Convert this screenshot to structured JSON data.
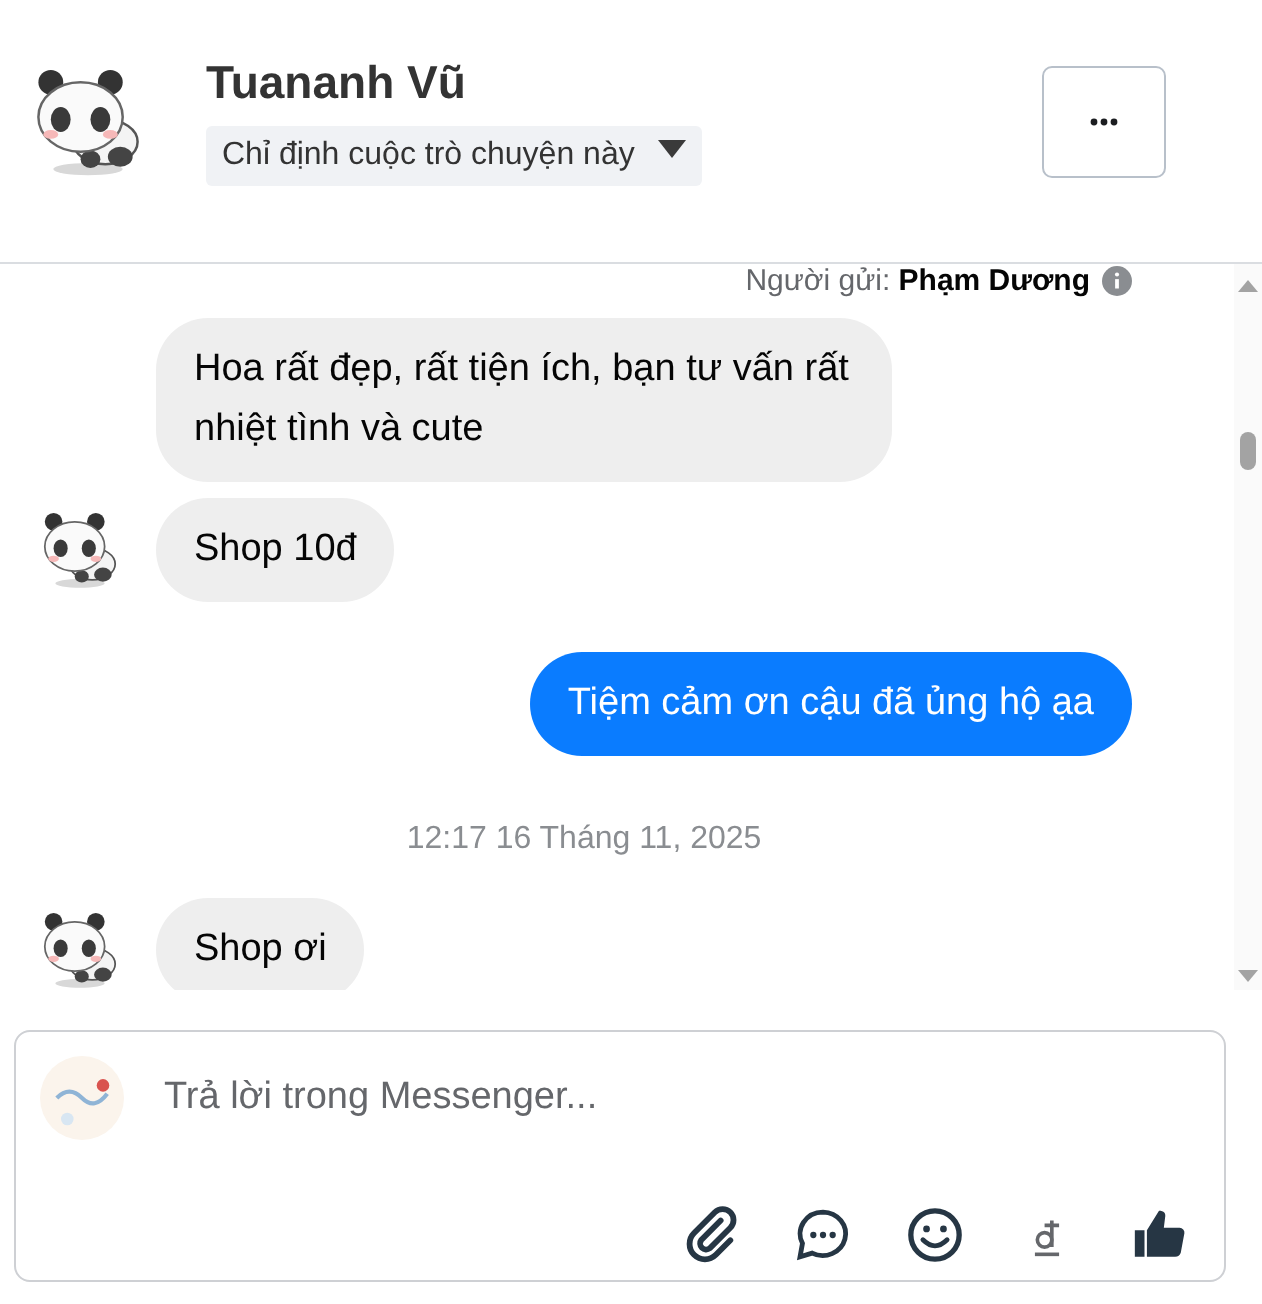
{
  "header": {
    "name": "Tuananh Vũ",
    "assign_label": "Chỉ định cuộc trò chuyện này"
  },
  "messages": [
    {
      "kind": "sender_note",
      "label": "Người gửi:",
      "sender": "Phạm Dương"
    },
    {
      "kind": "incoming",
      "text": "Hoa rất đẹp, rất tiện ích, bạn tư vấn rất nhiệt tình và cute",
      "avatar": false
    },
    {
      "kind": "incoming",
      "text": "Shop 10đ",
      "avatar": true
    },
    {
      "kind": "outgoing",
      "text": "Tiệm cảm ơn cậu đã ủng hộ ạa"
    },
    {
      "kind": "timestamp",
      "text": "12:17 16 Tháng 11, 2025"
    },
    {
      "kind": "incoming",
      "text": "Shop ơi",
      "avatar": true
    }
  ],
  "composer": {
    "placeholder": "Trả lời trong Messenger..."
  }
}
